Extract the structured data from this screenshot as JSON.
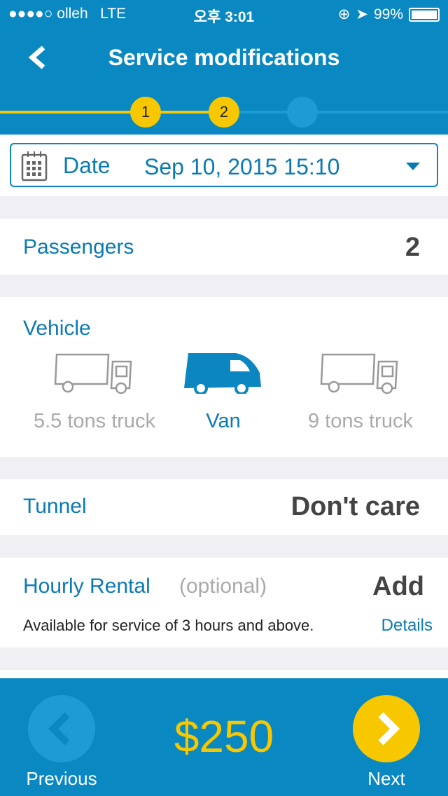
{
  "status_bar": {
    "signal": "●●●●○",
    "carrier": "olleh",
    "network": "LTE",
    "time": "오후 3:01",
    "battery": "99%"
  },
  "header": {
    "title": "Service modifications"
  },
  "steps": [
    {
      "label": "1",
      "state": "done"
    },
    {
      "label": "2",
      "state": "current"
    },
    {
      "label": "",
      "state": "pending"
    }
  ],
  "date": {
    "label": "Date",
    "value": "Sep 10, 2015 15:10"
  },
  "passengers": {
    "label": "Passengers",
    "value": "2"
  },
  "vehicle": {
    "label": "Vehicle",
    "options": [
      {
        "label": "5.5 tons truck",
        "selected": false
      },
      {
        "label": "Van",
        "selected": true
      },
      {
        "label": "9 tons truck",
        "selected": false
      }
    ]
  },
  "tunnel": {
    "label": "Tunnel",
    "value": "Don't care"
  },
  "hourly": {
    "label": "Hourly Rental",
    "optional": "(optional)",
    "action": "Add",
    "note": "Available for service of 3 hours and above.",
    "details": "Details"
  },
  "footer": {
    "previous": "Previous",
    "price": "$250",
    "next": "Next"
  },
  "colors": {
    "primary": "#0a88c2",
    "accent": "#f7c800",
    "text_blue": "#0b7ab3"
  }
}
